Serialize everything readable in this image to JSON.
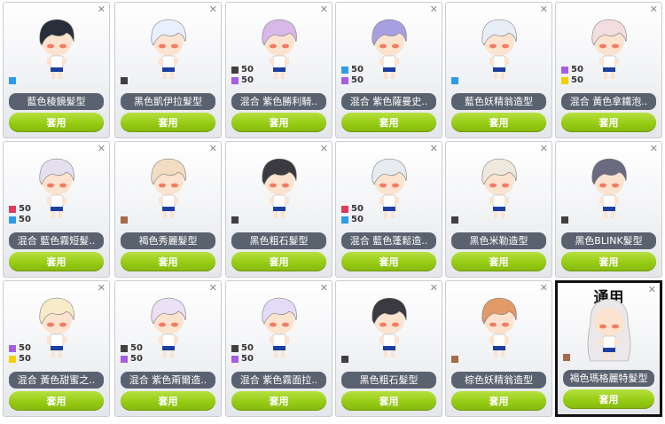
{
  "colors": {
    "black": "#404040",
    "blue": "#2e9be6",
    "red": "#e03a5c",
    "purple": "#a55ee0",
    "yellow": "#f3d000",
    "brown": "#a56a4a"
  },
  "action_label": "套用",
  "cards": [
    {
      "name": "藍色稜鏡髮型",
      "hair": "#2a2e3a",
      "swatches": [
        {
          "color": "blue",
          "num": ""
        }
      ]
    },
    {
      "name": "黑色凱伊拉髮型",
      "hair": "#e9f0ff",
      "swatches": [
        {
          "color": "black",
          "num": ""
        }
      ]
    },
    {
      "name": "混合  紫色勝利騎..",
      "hair": "#d8b8e8",
      "swatches": [
        {
          "color": "black",
          "num": "50"
        },
        {
          "color": "purple",
          "num": "50"
        }
      ]
    },
    {
      "name": "混合  紫色薩曼史..",
      "hair": "#a6a0e0",
      "swatches": [
        {
          "color": "blue",
          "num": "50"
        },
        {
          "color": "purple",
          "num": "50"
        }
      ]
    },
    {
      "name": "藍色妖精翁造型",
      "hair": "#e8eef8",
      "swatches": [
        {
          "color": "blue",
          "num": ""
        }
      ]
    },
    {
      "name": "混合  黃色拿鐵泡..",
      "hair": "#f2dede",
      "swatches": [
        {
          "color": "purple",
          "num": "50"
        },
        {
          "color": "yellow",
          "num": "50"
        }
      ]
    },
    {
      "name": "混合  藍色霧短髮..",
      "hair": "#e6dff0",
      "swatches": [
        {
          "color": "red",
          "num": "50"
        },
        {
          "color": "blue",
          "num": "50"
        }
      ]
    },
    {
      "name": "褐色秀麗髮型",
      "hair": "#f2dcc2",
      "swatches": [
        {
          "color": "brown",
          "num": ""
        }
      ]
    },
    {
      "name": "黑色粗石髮型",
      "hair": "#3a3a40",
      "swatches": [
        {
          "color": "black",
          "num": ""
        }
      ]
    },
    {
      "name": "混合  藍色蓬鬆造..",
      "hair": "#e8ecf0",
      "swatches": [
        {
          "color": "red",
          "num": "50"
        },
        {
          "color": "blue",
          "num": "50"
        }
      ]
    },
    {
      "name": "黑色米勒造型",
      "hair": "#efe8dc",
      "swatches": [
        {
          "color": "black",
          "num": ""
        }
      ]
    },
    {
      "name": "黑色BLINK髮型",
      "hair": "#6a6a80",
      "swatches": [
        {
          "color": "black",
          "num": ""
        }
      ]
    },
    {
      "name": "混合  黃色甜蜜之..",
      "hair": "#f6ecc8",
      "swatches": [
        {
          "color": "purple",
          "num": "50"
        },
        {
          "color": "yellow",
          "num": "50"
        }
      ]
    },
    {
      "name": "混合  紫色甭爾造..",
      "hair": "#ece0f4",
      "swatches": [
        {
          "color": "black",
          "num": "50"
        },
        {
          "color": "purple",
          "num": "50"
        }
      ]
    },
    {
      "name": "混合  紫色霧面拉..",
      "hair": "#e4dcf6",
      "swatches": [
        {
          "color": "black",
          "num": "50"
        },
        {
          "color": "purple",
          "num": "50"
        }
      ]
    },
    {
      "name": "黑色粗石髮型",
      "hair": "#3a3a40",
      "swatches": [
        {
          "color": "black",
          "num": ""
        }
      ]
    },
    {
      "name": "棕色妖精翁造型",
      "hair": "#e29a68",
      "swatches": [
        {
          "color": "brown",
          "num": ""
        }
      ]
    },
    {
      "name": "褐色瑪格麗特髮型",
      "hair": "#ece8ea",
      "swatches": [
        {
          "color": "brown",
          "num": ""
        }
      ],
      "tag": "通用",
      "long": true
    }
  ]
}
